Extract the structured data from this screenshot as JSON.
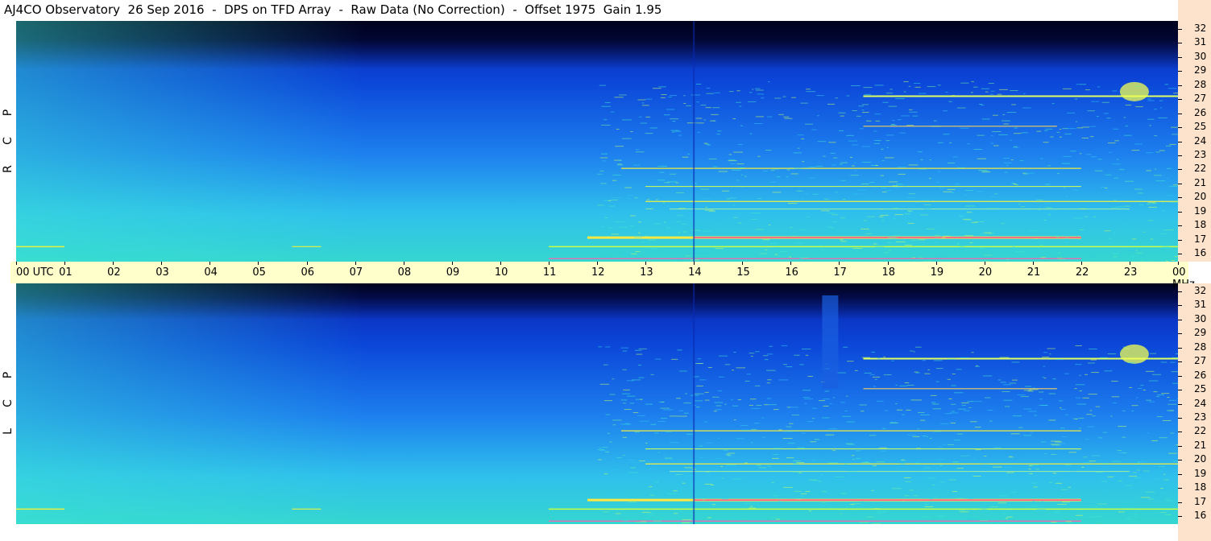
{
  "title": "AJ4CO Observatory  26 Sep 2016  -  DPS on TFD Array  -  Raw Data (No Correction)  -  Offset 1975  Gain 1.95",
  "time_axis": {
    "labels": [
      "00 UTC",
      "01",
      "02",
      "03",
      "04",
      "05",
      "06",
      "07",
      "08",
      "09",
      "10",
      "11",
      "12",
      "13",
      "14",
      "15",
      "16",
      "17",
      "18",
      "19",
      "20",
      "21",
      "22",
      "23",
      "00 MHz"
    ]
  },
  "panels": [
    {
      "polarization": [
        "R",
        "C",
        "P"
      ]
    },
    {
      "polarization": [
        "L",
        "C",
        "P"
      ]
    }
  ],
  "chart_data": {
    "type": "heatmap",
    "title": "AJ4CO Observatory  26 Sep 2016  -  DPS on TFD Array  -  Raw Data (No Correction)  -  Offset 1975  Gain 1.95",
    "xlabel": "UTC",
    "ylabel": "MHz",
    "x_ticks": [
      "00",
      "01",
      "02",
      "03",
      "04",
      "05",
      "06",
      "07",
      "08",
      "09",
      "10",
      "11",
      "12",
      "13",
      "14",
      "15",
      "16",
      "17",
      "18",
      "19",
      "20",
      "21",
      "22",
      "23",
      "00"
    ],
    "xlim": [
      0,
      24
    ],
    "y_ticks": [
      32,
      31,
      30,
      29,
      28,
      27,
      26,
      25,
      24,
      23,
      22,
      21,
      20,
      19,
      18,
      17,
      16
    ],
    "ylim": [
      16,
      32
    ],
    "panels": [
      "RCP",
      "LCP"
    ],
    "colormap": [
      "#000014",
      "#03036e",
      "#0a2fd6",
      "#1a8cf0",
      "#2dc6ec",
      "#35e0c8",
      "#ffff40",
      "#ff3080"
    ]
  }
}
